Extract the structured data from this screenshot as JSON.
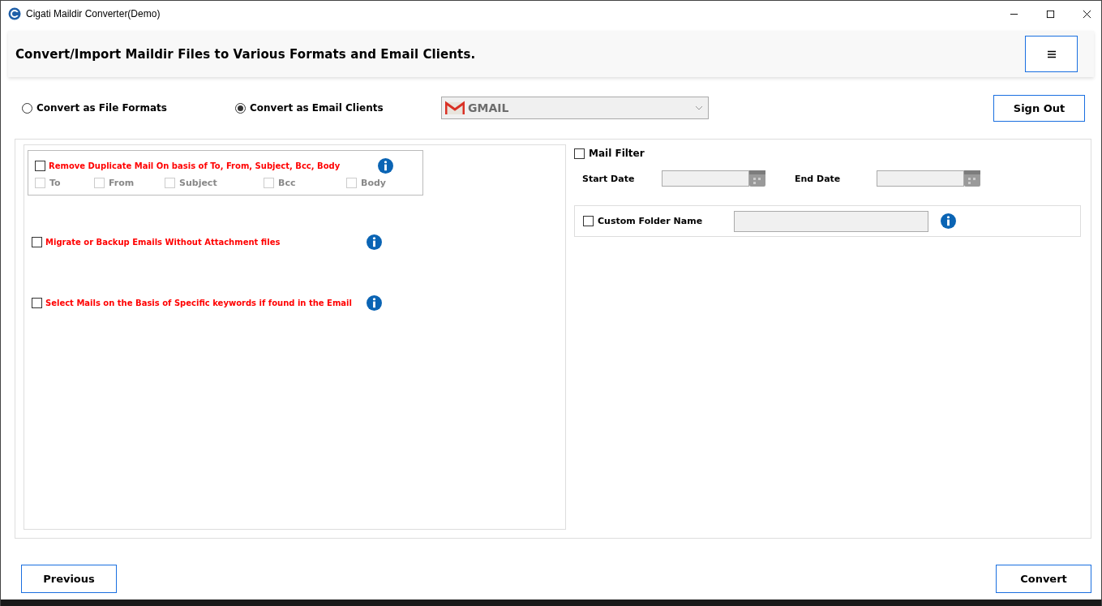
{
  "window": {
    "title": "Cigati Maildir Converter(Demo)"
  },
  "header": {
    "title": "Convert/Import Maildir Files to Various Formats and Email Clients."
  },
  "mode_options": [
    {
      "label": "Convert as File Formats",
      "selected": false
    },
    {
      "label": "Convert as Email Clients",
      "selected": true
    }
  ],
  "client_dropdown": {
    "value": "GMAIL",
    "disabled": true
  },
  "sign_out": "Sign Out",
  "duplicate_filter": {
    "label": "Remove Duplicate Mail On basis of To, From, Subject, Bcc, Body",
    "checked": false,
    "fields": [
      {
        "label": "To",
        "checked": false,
        "disabled": true
      },
      {
        "label": "From",
        "checked": false,
        "disabled": true
      },
      {
        "label": "Subject",
        "checked": false,
        "disabled": true
      },
      {
        "label": "Bcc",
        "checked": false,
        "disabled": true
      },
      {
        "label": "Body",
        "checked": false,
        "disabled": true
      }
    ]
  },
  "options": [
    {
      "label": "Migrate or Backup Emails Without Attachment files",
      "checked": false
    },
    {
      "label": "Select Mails on the Basis of Specific keywords if found in the Email",
      "checked": false
    }
  ],
  "mail_filter": {
    "label": "Mail Filter",
    "checked": false,
    "start_label": "Start Date",
    "end_label": "End Date"
  },
  "custom_folder": {
    "label": "Custom Folder Name",
    "checked": false
  },
  "buttons": {
    "previous": "Previous",
    "convert": "Convert"
  }
}
